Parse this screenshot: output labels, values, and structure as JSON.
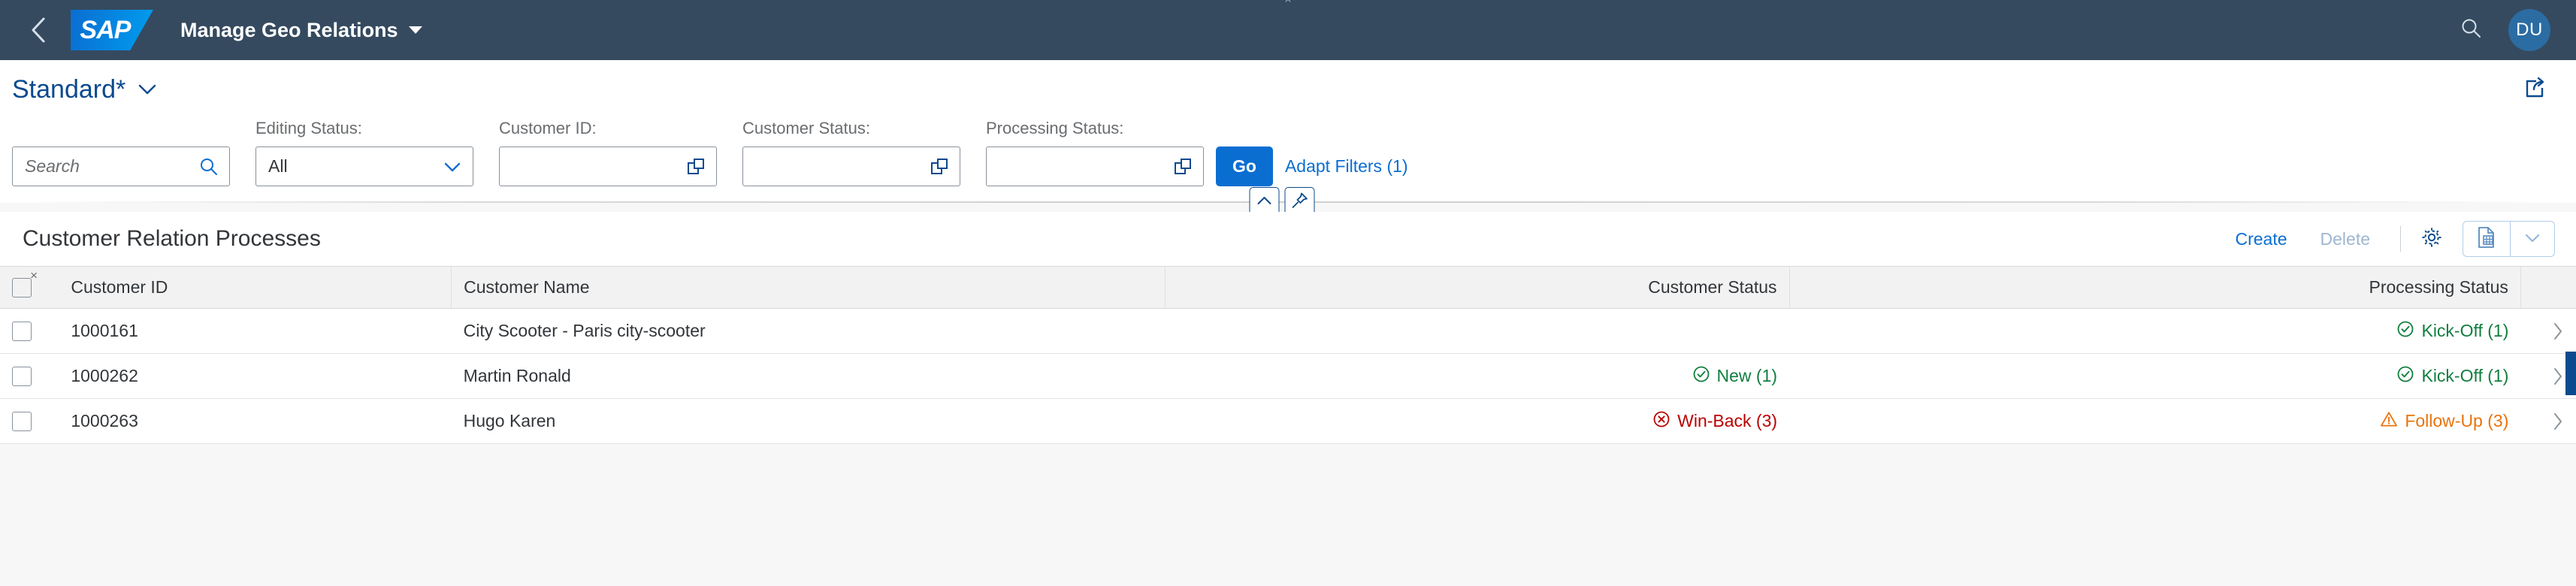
{
  "shell": {
    "back_icon": "chevron-left-icon",
    "logo_text": "SAP",
    "app_title": "Manage Geo Relations",
    "search_icon": "search-icon",
    "avatar_initials": "DU"
  },
  "variant": {
    "title": "Standard*",
    "chevron_icon": "chevron-down-icon",
    "share_icon": "share-icon"
  },
  "filters": {
    "search": {
      "placeholder": "Search",
      "value": "",
      "icon": "search-icon"
    },
    "fields": [
      {
        "label": "Editing Status:",
        "value": "All",
        "type": "select",
        "icon": "chevron-down-icon"
      },
      {
        "label": "Customer ID:",
        "value": "",
        "type": "valuehelp",
        "icon": "value-help-icon"
      },
      {
        "label": "Customer Status:",
        "value": "",
        "type": "valuehelp",
        "icon": "value-help-icon"
      },
      {
        "label": "Processing Status:",
        "value": "",
        "type": "valuehelp",
        "icon": "value-help-icon"
      }
    ],
    "go_label": "Go",
    "adapt_label": "Adapt Filters (1)",
    "collapse_icon": "chevron-up-icon",
    "pin_icon": "pin-icon"
  },
  "table": {
    "title": "Customer Relation Processes",
    "toolbar": {
      "create_label": "Create",
      "delete_label": "Delete",
      "settings_icon": "gear-icon",
      "export_icon": "export-to-spreadsheet-icon",
      "export_arrow_icon": "chevron-down-icon"
    },
    "columns": [
      {
        "label": "Customer ID",
        "align": "left"
      },
      {
        "label": "Customer Name",
        "align": "left"
      },
      {
        "label": "Customer Status",
        "align": "right"
      },
      {
        "label": "Processing Status",
        "align": "right"
      }
    ],
    "select_all_icon": "deselect-all-icon",
    "rows": [
      {
        "customer_id": "1000161",
        "customer_name": "City Scooter - Paris city-scooter",
        "customer_status": {
          "text": "",
          "tone": "none",
          "icon": ""
        },
        "processing_status": {
          "text": "Kick-Off (1)",
          "tone": "positive",
          "icon": "success-icon"
        }
      },
      {
        "customer_id": "1000262",
        "customer_name": "Martin Ronald",
        "customer_status": {
          "text": "New (1)",
          "tone": "positive",
          "icon": "success-icon"
        },
        "processing_status": {
          "text": "Kick-Off (1)",
          "tone": "positive",
          "icon": "success-icon"
        }
      },
      {
        "customer_id": "1000263",
        "customer_name": "Hugo Karen",
        "customer_status": {
          "text": "Win-Back (3)",
          "tone": "negative",
          "icon": "error-icon"
        },
        "processing_status": {
          "text": "Follow-Up (3)",
          "tone": "warning",
          "icon": "warning-icon"
        }
      }
    ],
    "row_nav_icon": "chevron-right-icon"
  },
  "colors": {
    "shell_bg": "#354a5f",
    "accent": "#0a6ed1",
    "positive": "#107e3e",
    "negative": "#bb0000",
    "warning": "#e9730c",
    "link": "#0a4a8e"
  }
}
